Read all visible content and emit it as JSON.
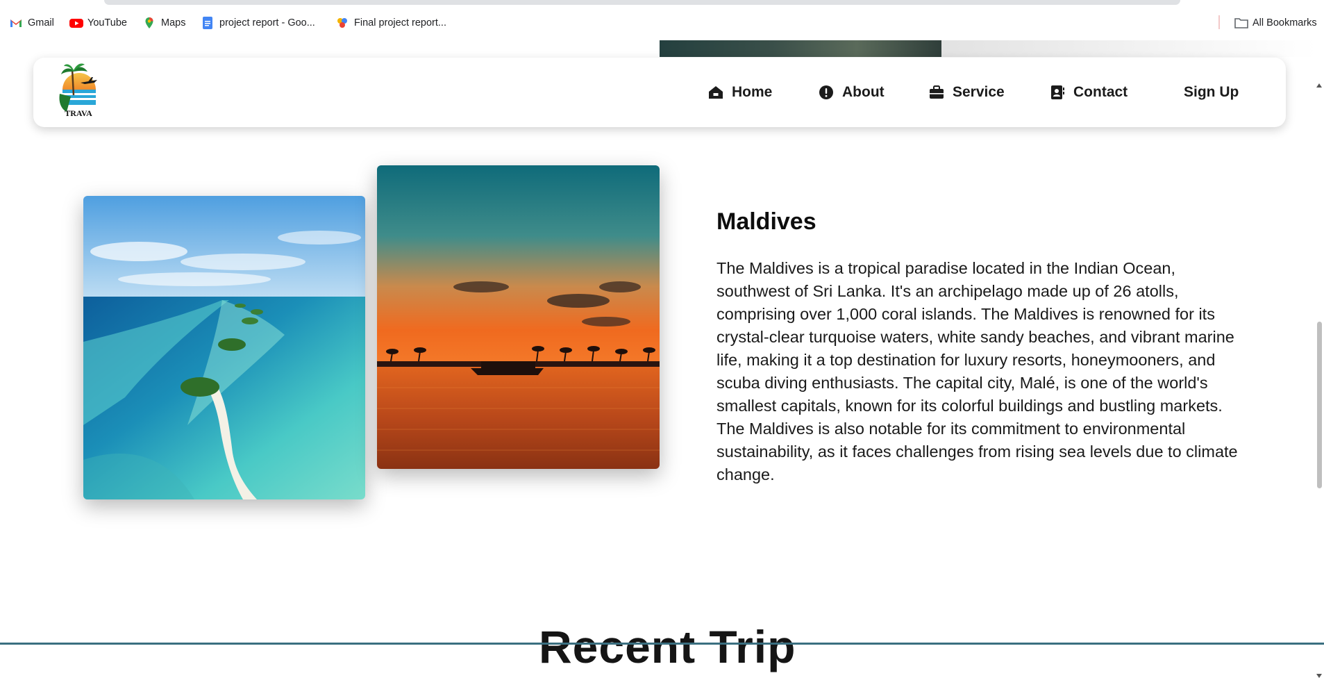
{
  "bookmarks": {
    "items": [
      {
        "label": "Gmail",
        "icon": "gmail-icon"
      },
      {
        "label": "YouTube",
        "icon": "youtube-icon"
      },
      {
        "label": "Maps",
        "icon": "maps-icon"
      },
      {
        "label": "project report - Goo...",
        "icon": "google-docs-icon"
      },
      {
        "label": "Final project report...",
        "icon": "project-report-icon"
      }
    ],
    "all_bookmarks": "All Bookmarks"
  },
  "navbar": {
    "logo_text": "TRAVA",
    "items": [
      {
        "label": "Home",
        "icon": "home-icon"
      },
      {
        "label": "About",
        "icon": "info-icon"
      },
      {
        "label": "Service",
        "icon": "briefcase-icon"
      },
      {
        "label": "Contact",
        "icon": "contact-icon"
      },
      {
        "label": "Sign Up",
        "icon": ""
      }
    ]
  },
  "destination": {
    "title": "Maldives",
    "description": "The Maldives is a tropical paradise located in the Indian Ocean, southwest of Sri Lanka. It's an archipelago made up of 26 atolls, comprising over 1,000 coral islands. The Maldives is renowned for its crystal-clear turquoise waters, white sandy beaches, and vibrant marine life, making it a top destination for luxury resorts, honeymooners, and scuba diving enthusiasts. The capital city, Malé, is one of the world's smallest capitals, known for its colorful buildings and bustling markets. The Maldives is also notable for its commitment to environmental sustainability, as it faces challenges from rising sea levels due to climate change.",
    "images": [
      {
        "subject": "aerial-atoll-photo"
      },
      {
        "subject": "sunset-boat-photo"
      }
    ]
  },
  "next_section": {
    "heading": "Recent Trip"
  },
  "colors": {
    "accent_dark": "#1b1b1b",
    "bottom_border": "#3a6f80"
  }
}
